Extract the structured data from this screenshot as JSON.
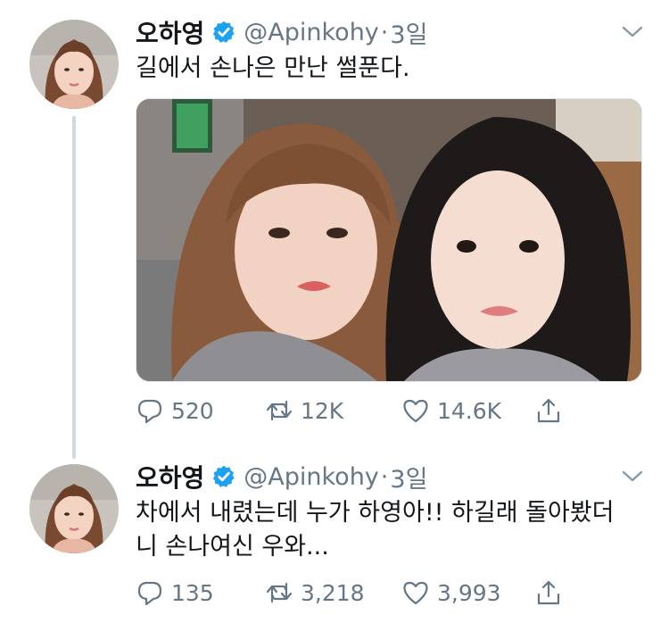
{
  "tweets": [
    {
      "author_name": "오하영",
      "handle": "@Apinkohy",
      "separator": "·",
      "time": "3일",
      "text": "길에서 손나은 만난 썰푼다.",
      "counts": {
        "reply": "520",
        "retweet": "12K",
        "like": "14.6K"
      },
      "has_photo": true
    },
    {
      "author_name": "오하영",
      "handle": "@Apinkohy",
      "separator": "·",
      "time": "3일",
      "text_line1": "차에서 내렸는데 누가 하영아!! 하길래 돌아봤더",
      "text_line2": "니 손나여신 우와...",
      "counts": {
        "reply": "135",
        "retweet": "3,218",
        "like": "3,993"
      }
    }
  ],
  "colors": {
    "verified": "#1da1f2",
    "muted": "#657786",
    "text": "#14171a",
    "thread_line": "#cfd9de"
  },
  "icons": [
    "verified-badge-icon",
    "chevron-down-icon",
    "reply-icon",
    "retweet-icon",
    "like-icon",
    "share-icon"
  ]
}
